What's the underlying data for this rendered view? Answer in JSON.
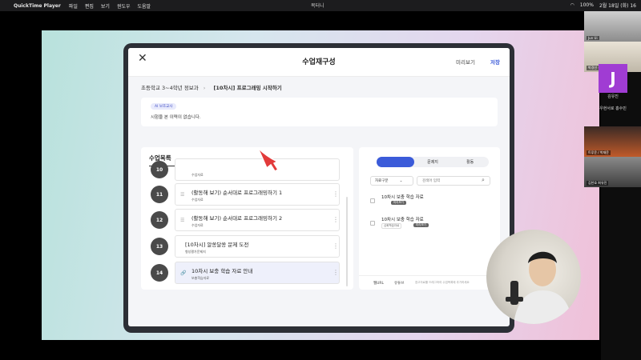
{
  "menubar": {
    "app": "QuickTime Player",
    "menus": [
      "파일",
      "편집",
      "보기",
      "윈도우",
      "도움말"
    ],
    "window_title": "목터니",
    "battery": "100%",
    "datetime": "2월 18일 (화) 16"
  },
  "header": {
    "title": "수업재구성",
    "preview_label": "미리보기",
    "save_label": "저장"
  },
  "breadcrumb": {
    "course": "초등학교 3~4학년 정보과",
    "lesson": "[10차시] 프로그래밍 시작하기"
  },
  "ai_box": {
    "badge": "AI 보조교사",
    "message": "시험을 본 이력이 없습니다."
  },
  "lesson_list": {
    "title": "수업목록",
    "items": [
      {
        "num": "10",
        "title": "",
        "tag": "수업자료"
      },
      {
        "num": "11",
        "title": "(활동해 보기) 순서대로 프로그래밍하기 1",
        "tag": "수업자료"
      },
      {
        "num": "12",
        "title": "(활동해 보기) 순서대로 프로그래밍하기 2",
        "tag": "수업자료"
      },
      {
        "num": "13",
        "title": "[10차시] 알쏭달쏭 문제 도전",
        "tag": "형성평가문제지"
      },
      {
        "num": "14",
        "title": "10차시 보충 학습 자료 안내",
        "tag": "보충학습자료"
      }
    ]
  },
  "resource_panel": {
    "tabs": [
      "",
      "문제지",
      "활동"
    ],
    "active_tab": 0,
    "filter_label": "자료구분",
    "search_placeholder": "검색어 입력",
    "items": [
      {
        "title": "10차시 보충 학습 자료",
        "tag": "",
        "button": "미리보기"
      },
      {
        "title": "10차시 보충 학습 자료",
        "tag": "심화학습자료",
        "button": "미리보기"
      }
    ],
    "footer": {
      "left": "웹URL",
      "mid": "유튜브",
      "note": "참고자료를 드래그하여 수업목록에 추가하세요"
    }
  },
  "participants": {
    "names": [
      "Jun Ui",
      "박경선 권유진",
      "김유진",
      "우현서로 홍수민",
      "트루윤 / 박재윤",
      "김찬호 최유진"
    ],
    "avatar_letter": "J"
  },
  "colors": {
    "accent": "#3b5bd9",
    "avatar": "#a03cd3"
  }
}
